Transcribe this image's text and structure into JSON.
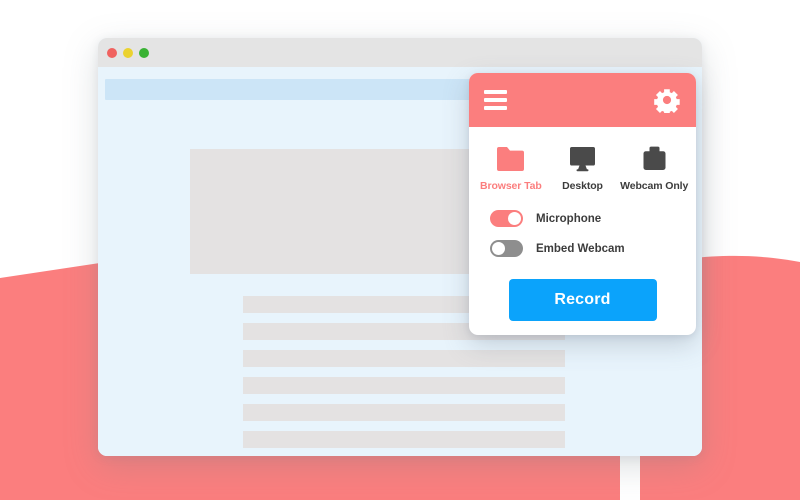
{
  "theme": {
    "coral": "#FB7E7E",
    "record_blue": "#0BA3FB",
    "page_blue": "#E8F4FC",
    "url_bar_blue": "#CCE5F7",
    "placeholder_gray": "#E4E2E2",
    "titlebar_gray": "#E4E4E4",
    "toggle_off_gray": "#8E8E8E",
    "label_dark": "#3C3C3C",
    "white": "#FFFFFF",
    "canvas_white": "#FFFFFF"
  },
  "browser_window": {
    "titlebar": {
      "traffic_lights": [
        {
          "name": "close",
          "color": "#F0625F"
        },
        {
          "name": "minimize",
          "color": "#EBD22F"
        },
        {
          "name": "maximize",
          "color": "#39B234"
        }
      ]
    },
    "viewport": {
      "url_bar_value": "",
      "hero_placeholder": "",
      "text_line_count": 6
    }
  },
  "recorder_panel": {
    "header": {
      "menu_icon": "hamburger-menu-icon",
      "settings_icon": "gear-icon"
    },
    "sources": [
      {
        "id": "browser-tab",
        "label": "Browser Tab",
        "icon": "folder-icon",
        "active": true
      },
      {
        "id": "desktop",
        "label": "Desktop",
        "icon": "monitor-icon",
        "active": false
      },
      {
        "id": "webcam-only",
        "label": "Webcam Only",
        "icon": "camera-icon",
        "active": false
      }
    ],
    "toggles": [
      {
        "id": "microphone",
        "label": "Microphone",
        "state": "on"
      },
      {
        "id": "embed-webcam",
        "label": "Embed Webcam",
        "state": "off"
      }
    ],
    "record_button": {
      "label": "Record"
    }
  }
}
